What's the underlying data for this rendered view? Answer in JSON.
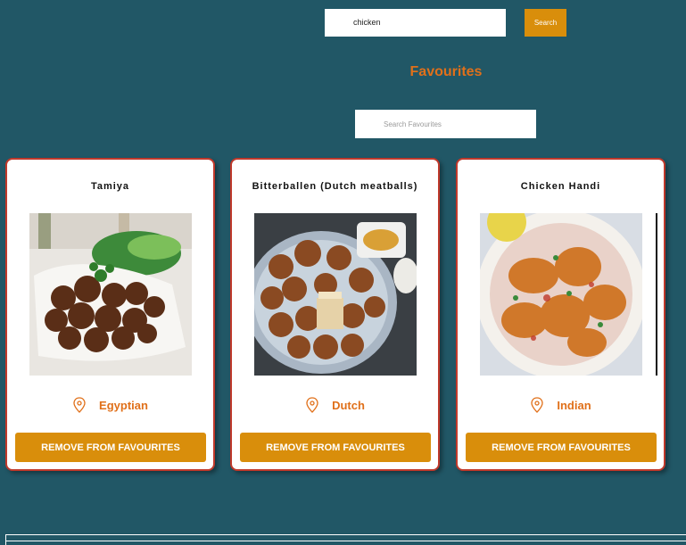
{
  "search": {
    "value": "chicken",
    "button_label": "Search"
  },
  "favourites": {
    "heading": "Favourites",
    "search_placeholder": "Search Favourites",
    "cards": [
      {
        "title": "Tamiya",
        "area": "Egyptian",
        "button_label": "REMOVE FROM FAVOURITES",
        "image_desc": "falafel-photo"
      },
      {
        "title": "Bitterballen (Dutch meatballs)",
        "area": "Dutch",
        "button_label": "REMOVE FROM FAVOURITES",
        "image_desc": "bitterballen-photo"
      },
      {
        "title": "Chicken Handi",
        "area": "Indian",
        "button_label": "REMOVE FROM FAVOURITES",
        "image_desc": "chicken-handi-photo"
      }
    ]
  },
  "colors": {
    "background": "#215766",
    "accent": "#d98e0b",
    "heading": "#e0701a",
    "card_border": "#c0392b"
  }
}
